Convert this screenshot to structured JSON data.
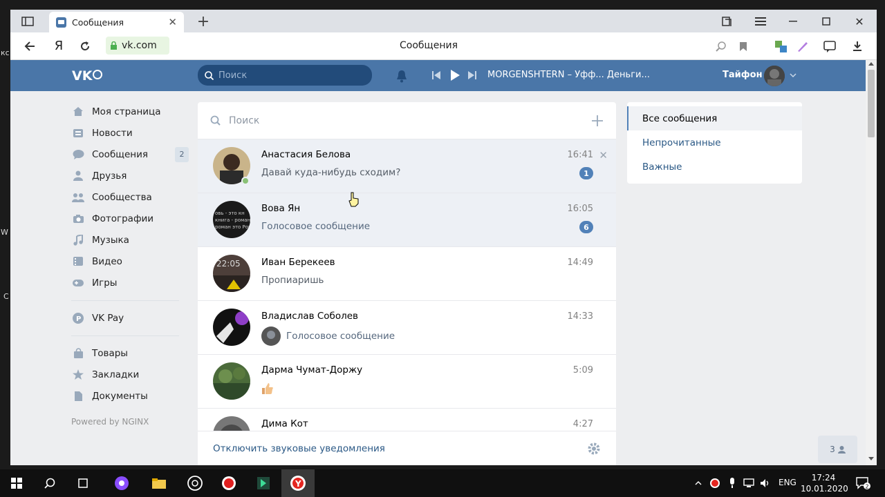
{
  "browser": {
    "tab_title": "Сообщения",
    "url": "vk.com",
    "page_title": "Сообщения",
    "yandex_logo": "Я"
  },
  "vk": {
    "search_placeholder": "Поиск",
    "player_track": "MORGENSHTERN – Уфф... Деньги...",
    "user_name": "Тайфон"
  },
  "sidebar": {
    "items": [
      {
        "label": "Моя страница",
        "icon": "home-icon"
      },
      {
        "label": "Новости",
        "icon": "news-icon"
      },
      {
        "label": "Сообщения",
        "icon": "messages-icon",
        "badge": "2"
      },
      {
        "label": "Друзья",
        "icon": "friends-icon"
      },
      {
        "label": "Сообщества",
        "icon": "groups-icon"
      },
      {
        "label": "Фотографии",
        "icon": "camera-icon"
      },
      {
        "label": "Музыка",
        "icon": "music-icon"
      },
      {
        "label": "Видео",
        "icon": "video-icon"
      },
      {
        "label": "Игры",
        "icon": "games-icon"
      }
    ],
    "vkpay": "VK Pay",
    "extra": [
      {
        "label": "Товары",
        "icon": "bag-icon"
      },
      {
        "label": "Закладки",
        "icon": "star-icon"
      },
      {
        "label": "Документы",
        "icon": "document-icon"
      }
    ],
    "powered": "Powered by NGINX"
  },
  "dialogs": {
    "search_placeholder": "Поиск",
    "rows": [
      {
        "name": "Анастасия Белова",
        "message": "Давай куда-нибудь сходим?",
        "time": "16:41",
        "unread": "1"
      },
      {
        "name": "Вова Ян",
        "message": "Голосовое сообщение",
        "time": "16:05",
        "unread": "6"
      },
      {
        "name": "Иван Берекеев",
        "message": "Пропиаришь",
        "time": "14:49"
      },
      {
        "name": "Владислав Соболев",
        "message": "Голосовое сообщение",
        "time": "14:33"
      },
      {
        "name": "Дарма Чумат-Доржу",
        "message": "",
        "time": "5:09"
      },
      {
        "name": "Дима Кот",
        "message": "",
        "time": "4:27"
      }
    ],
    "footer": "Отключить звуковые уведомления"
  },
  "filters": {
    "items": [
      "Все сообщения",
      "Непрочитанные",
      "Важные"
    ]
  },
  "chat_count": "3",
  "taskbar": {
    "lang": "ENG",
    "time": "17:24",
    "date": "10.01.2020",
    "notify_count": "2"
  },
  "colors": {
    "vk_header": "#4a76a8",
    "accent": "#5181b8",
    "link": "#2a5885"
  }
}
